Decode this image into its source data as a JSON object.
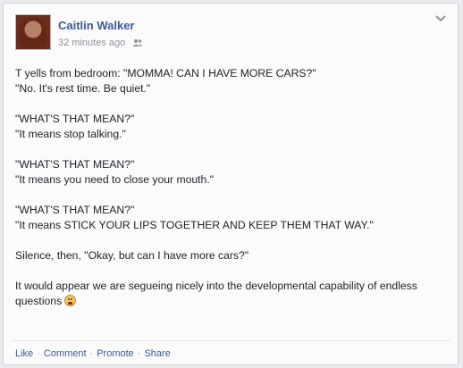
{
  "post": {
    "author": "Caitlin Walker",
    "timestamp": "32 minutes ago",
    "privacy_icon": "friends-icon",
    "menu_icon": "chevron-down-icon",
    "paragraphs": [
      [
        "T yells from bedroom: \"MOMMA! CAN I HAVE MORE CARS?\"",
        "\"No. It's rest time. Be quiet.\""
      ],
      [
        "\"WHAT'S THAT MEAN?\"",
        "\"It means stop talking.\""
      ],
      [
        "\"WHAT'S THAT MEAN?\"",
        "\"It means you need to close your mouth.\""
      ],
      [
        "\"WHAT'S THAT MEAN?\"",
        "\"It means STICK YOUR LIPS TOGETHER AND KEEP THEM THAT WAY.\""
      ],
      [
        "Silence, then, \"Okay, but can I have more cars?\""
      ]
    ],
    "final_text": "It would appear we are segueing nicely into the developmental capability of endless questions",
    "final_emoji": "tongue-tied-emoji"
  },
  "actions": {
    "like": "Like",
    "comment": "Comment",
    "promote": "Promote",
    "share": "Share",
    "separator": "·"
  }
}
